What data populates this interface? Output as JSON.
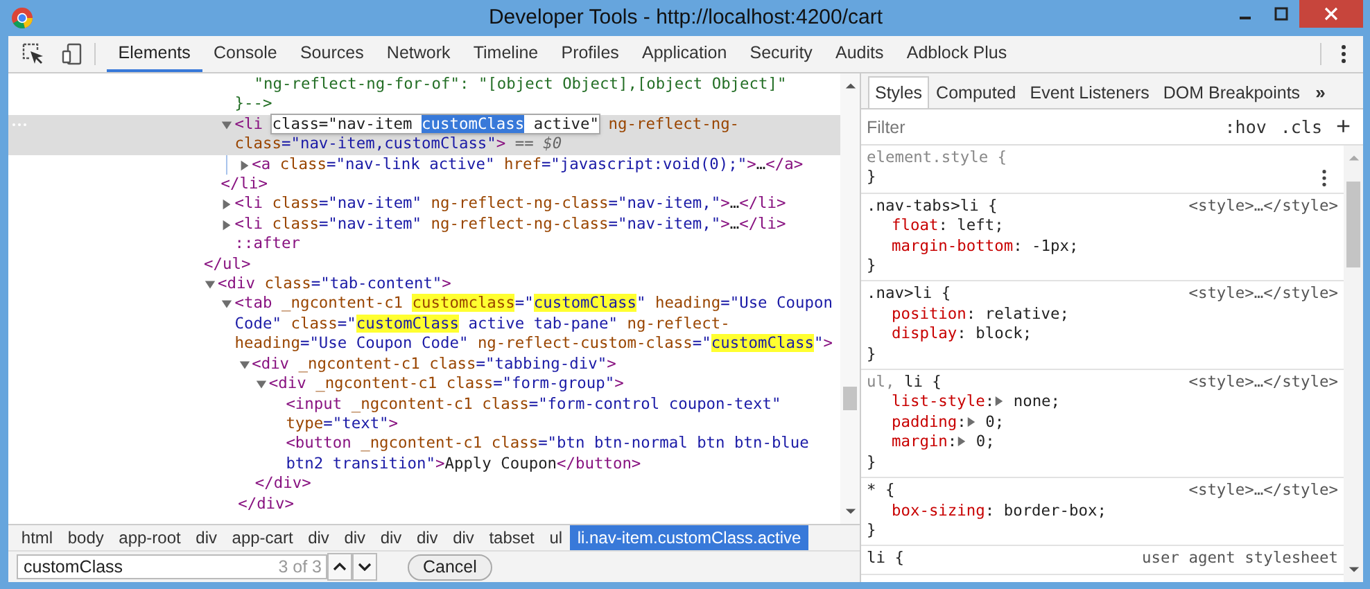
{
  "window": {
    "title": "Developer Tools - http://localhost:4200/cart"
  },
  "toolbar": {
    "tabs": [
      {
        "label": "Elements",
        "selected": true
      },
      {
        "label": "Console",
        "selected": false
      },
      {
        "label": "Sources",
        "selected": false
      },
      {
        "label": "Network",
        "selected": false
      },
      {
        "label": "Timeline",
        "selected": false
      },
      {
        "label": "Profiles",
        "selected": false
      },
      {
        "label": "Application",
        "selected": false
      },
      {
        "label": "Security",
        "selected": false
      },
      {
        "label": "Audits",
        "selected": false
      },
      {
        "label": "Adblock Plus",
        "selected": false
      }
    ]
  },
  "tree": [
    {
      "kind": "fragment",
      "children": [
        {
          "kind": "comment",
          "lines": [
            "\"ng-reflect-ng-for-of\": \"[object Object],[object Object]\"",
            "}-->"
          ]
        },
        {
          "kind": "element",
          "expanded": true,
          "selected": true,
          "open": [
            {
              "kind": "tag",
              "text": "<li "
            },
            {
              "kind": "editor",
              "parts": [
                {
                  "kind": "plain",
                  "text": "class=\"nav-item "
                },
                {
                  "kind": "selection",
                  "text": "customClass"
                },
                {
                  "kind": "plain",
                  "text": " active\""
                }
              ]
            },
            {
              "kind": "attr",
              "text": " ng-reflect-ng-class"
            },
            {
              "kind": "val",
              "text": "=\"nav-item,customClass\""
            },
            {
              "kind": "tag",
              "text": ">"
            },
            {
              "kind": "ref",
              "text": " == "
            },
            {
              "kind": "refvar",
              "text": "$0"
            }
          ],
          "children": [
            {
              "kind": "element",
              "expanded": false,
              "selected": false,
              "open": [
                {
                  "kind": "tag",
                  "text": "<a"
                },
                {
                  "kind": "attr",
                  "text": " class"
                },
                {
                  "kind": "val",
                  "text": "=\"nav-link active\""
                },
                {
                  "kind": "attr",
                  "text": " href"
                },
                {
                  "kind": "val",
                  "text": "=\"javascript:void(0);\""
                },
                {
                  "kind": "tag",
                  "text": ">"
                },
                {
                  "kind": "plain",
                  "text": "…"
                },
                {
                  "kind": "tag",
                  "text": "</a>"
                }
              ]
            }
          ],
          "close": [
            {
              "kind": "tag",
              "text": "</li>"
            }
          ]
        },
        {
          "kind": "element",
          "expanded": false,
          "selected": false,
          "open": [
            {
              "kind": "tag",
              "text": "<li"
            },
            {
              "kind": "attr",
              "text": " class"
            },
            {
              "kind": "val",
              "text": "=\"nav-item\""
            },
            {
              "kind": "attr",
              "text": " ng-reflect-ng-class"
            },
            {
              "kind": "val",
              "text": "=\"nav-item,\""
            },
            {
              "kind": "tag",
              "text": ">"
            },
            {
              "kind": "plain",
              "text": "…"
            },
            {
              "kind": "tag",
              "text": "</li>"
            }
          ]
        },
        {
          "kind": "element",
          "expanded": false,
          "selected": false,
          "open": [
            {
              "kind": "tag",
              "text": "<li"
            },
            {
              "kind": "attr",
              "text": " class"
            },
            {
              "kind": "val",
              "text": "=\"nav-item\""
            },
            {
              "kind": "attr",
              "text": " ng-reflect-ng-class"
            },
            {
              "kind": "val",
              "text": "=\"nav-item,\""
            },
            {
              "kind": "tag",
              "text": ">"
            },
            {
              "kind": "plain",
              "text": "…"
            },
            {
              "kind": "tag",
              "text": "</li>"
            }
          ]
        },
        {
          "kind": "leaf",
          "open": [
            {
              "kind": "tag",
              "text": "::after"
            }
          ]
        }
      ],
      "close": [
        {
          "kind": "tag",
          "text": "</ul>"
        }
      ]
    },
    {
      "kind": "element",
      "expanded": true,
      "selected": false,
      "open": [
        {
          "kind": "tag",
          "text": "<div"
        },
        {
          "kind": "attr",
          "text": " class"
        },
        {
          "kind": "val",
          "text": "=\"tab-content\""
        },
        {
          "kind": "tag",
          "text": ">"
        }
      ],
      "children": [
        {
          "kind": "element",
          "expanded": true,
          "selected": false,
          "open": [
            {
              "kind": "tag",
              "text": "<tab"
            },
            {
              "kind": "attr",
              "text": " _ngcontent-c1 "
            },
            {
              "kind": "attr-match",
              "text": "customclass"
            },
            {
              "kind": "val",
              "text": "=\""
            },
            {
              "kind": "val-match",
              "text": "customClass"
            },
            {
              "kind": "val",
              "text": "\""
            },
            {
              "kind": "attr",
              "text": " heading"
            },
            {
              "kind": "val",
              "text": "=\"Use Coupon Code\""
            },
            {
              "kind": "attr",
              "text": " class"
            },
            {
              "kind": "val",
              "text": "=\""
            },
            {
              "kind": "val-match",
              "text": "customClass"
            },
            {
              "kind": "val",
              "text": " active tab-pane\""
            },
            {
              "kind": "attr",
              "text": " ng-reflect-heading"
            },
            {
              "kind": "val",
              "text": "=\"Use Coupon Code\""
            },
            {
              "kind": "attr",
              "text": " ng-reflect-custom-class"
            },
            {
              "kind": "val",
              "text": "=\""
            },
            {
              "kind": "val-match",
              "text": "customClass"
            },
            {
              "kind": "val",
              "text": "\""
            },
            {
              "kind": "tag",
              "text": ">"
            }
          ],
          "children": [
            {
              "kind": "element",
              "expanded": true,
              "selected": false,
              "open": [
                {
                  "kind": "tag",
                  "text": "<div"
                },
                {
                  "kind": "attr",
                  "text": " _ngcontent-c1"
                },
                {
                  "kind": "attr",
                  "text": " class"
                },
                {
                  "kind": "val",
                  "text": "=\"tabbing-div\""
                },
                {
                  "kind": "tag",
                  "text": ">"
                }
              ],
              "children": [
                {
                  "kind": "element",
                  "expanded": true,
                  "selected": false,
                  "open": [
                    {
                      "kind": "tag",
                      "text": "<div"
                    },
                    {
                      "kind": "attr",
                      "text": " _ngcontent-c1"
                    },
                    {
                      "kind": "attr",
                      "text": " class"
                    },
                    {
                      "kind": "val",
                      "text": "=\"form-group\""
                    },
                    {
                      "kind": "tag",
                      "text": ">"
                    }
                  ],
                  "children": [
                    {
                      "kind": "leaf",
                      "open": [
                        {
                          "kind": "tag",
                          "text": "<input"
                        },
                        {
                          "kind": "attr",
                          "text": " _ngcontent-c1"
                        },
                        {
                          "kind": "attr",
                          "text": " class"
                        },
                        {
                          "kind": "val",
                          "text": "=\"form-control coupon-text\""
                        },
                        {
                          "kind": "attr",
                          "text": " type"
                        },
                        {
                          "kind": "val",
                          "text": "=\"text\""
                        },
                        {
                          "kind": "tag",
                          "text": ">"
                        }
                      ]
                    },
                    {
                      "kind": "leaf",
                      "open": [
                        {
                          "kind": "tag",
                          "text": "<button"
                        },
                        {
                          "kind": "attr",
                          "text": " _ngcontent-c1"
                        },
                        {
                          "kind": "attr",
                          "text": " class"
                        },
                        {
                          "kind": "val",
                          "text": "=\"btn btn-normal btn btn-blue btn2 transition\""
                        },
                        {
                          "kind": "tag",
                          "text": ">"
                        },
                        {
                          "kind": "plain",
                          "text": "Apply Coupon"
                        },
                        {
                          "kind": "tag",
                          "text": "</button>"
                        }
                      ]
                    }
                  ],
                  "close": [
                    {
                      "kind": "tag",
                      "text": "</div>"
                    }
                  ]
                }
              ],
              "close": [
                {
                  "kind": "tag",
                  "text": "</div>"
                }
              ]
            }
          ]
        }
      ]
    }
  ],
  "breadcrumbs": [
    {
      "label": "html",
      "selected": false
    },
    {
      "label": "body",
      "selected": false
    },
    {
      "label": "app-root",
      "selected": false
    },
    {
      "label": "div",
      "selected": false
    },
    {
      "label": "app-cart",
      "selected": false
    },
    {
      "label": "div",
      "selected": false
    },
    {
      "label": "div",
      "selected": false
    },
    {
      "label": "div",
      "selected": false
    },
    {
      "label": "div",
      "selected": false
    },
    {
      "label": "div",
      "selected": false
    },
    {
      "label": "tabset",
      "selected": false
    },
    {
      "label": "ul",
      "selected": false
    },
    {
      "label": "li.nav-item.customClass.active",
      "selected": true
    }
  ],
  "search": {
    "value": "customClass",
    "count": "3 of 3",
    "cancel": "Cancel"
  },
  "sidebar": {
    "tabs": [
      {
        "label": "Styles",
        "selected": true
      },
      {
        "label": "Computed",
        "selected": false
      },
      {
        "label": "Event Listeners",
        "selected": false
      },
      {
        "label": "DOM Breakpoints",
        "selected": false
      }
    ],
    "more": "»",
    "filter": {
      "placeholder": "Filter"
    },
    "hov": ":hov",
    "cls": ".cls",
    "add": "+",
    "rules": [
      {
        "selector": [
          {
            "text": "element.style {",
            "matched": false
          }
        ],
        "menu": true,
        "close": "}"
      },
      {
        "selector": [
          {
            "text": ".nav-tabs>li {",
            "matched": true
          }
        ],
        "source": "<style>…</style>",
        "menu": false,
        "props": [
          {
            "name": "float",
            "sep": ":",
            "expandable": false,
            "value": " left;"
          },
          {
            "name": "margin-bottom",
            "sep": ":",
            "expandable": false,
            "value": " -1px;"
          }
        ],
        "close": "}"
      },
      {
        "selector": [
          {
            "text": ".nav>li {",
            "matched": true
          }
        ],
        "source": "<style>…</style>",
        "menu": false,
        "props": [
          {
            "name": "position",
            "sep": ":",
            "expandable": false,
            "value": " relative;"
          },
          {
            "name": "display",
            "sep": ":",
            "expandable": false,
            "value": " block;"
          }
        ],
        "close": "}"
      },
      {
        "selector": [
          {
            "text": "ul,",
            "matched": false
          },
          {
            "text": " li {",
            "matched": true
          }
        ],
        "source": "<style>…</style>",
        "menu": false,
        "props": [
          {
            "name": "list-style",
            "sep": ":",
            "expandable": true,
            "value": " none;"
          },
          {
            "name": "padding",
            "sep": ":",
            "expandable": true,
            "value": " 0;"
          },
          {
            "name": "margin",
            "sep": ":",
            "expandable": true,
            "value": " 0;"
          }
        ],
        "close": "}"
      },
      {
        "selector": [
          {
            "text": "* {",
            "matched": true
          }
        ],
        "source": "<style>…</style>",
        "menu": false,
        "props": [
          {
            "name": "box-sizing",
            "sep": ":",
            "expandable": false,
            "value": " border-box;"
          }
        ],
        "close": "}"
      },
      {
        "selector": [
          {
            "text": "li {",
            "matched": true
          }
        ],
        "source": "user agent stylesheet"
      }
    ]
  }
}
